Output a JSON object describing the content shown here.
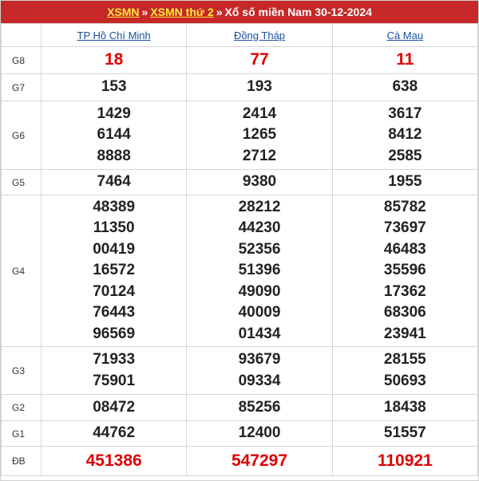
{
  "header": {
    "link1": "XSMN",
    "sep1": "»",
    "link2": "XSMN thứ 2",
    "sep2": "»",
    "title": "Xổ số miền Nam 30-12-2024"
  },
  "provinces": [
    "TP Hồ Chí Minh",
    "Đồng Tháp",
    "Cà Mau"
  ],
  "prizes": [
    {
      "label": "G8",
      "values": [
        [
          "18"
        ],
        [
          "77"
        ],
        [
          "11"
        ]
      ]
    },
    {
      "label": "G7",
      "values": [
        [
          "153"
        ],
        [
          "193"
        ],
        [
          "638"
        ]
      ]
    },
    {
      "label": "G6",
      "values": [
        [
          "1429",
          "6144",
          "8888"
        ],
        [
          "2414",
          "1265",
          "2712"
        ],
        [
          "3617",
          "8412",
          "2585"
        ]
      ]
    },
    {
      "label": "G5",
      "values": [
        [
          "7464"
        ],
        [
          "9380"
        ],
        [
          "1955"
        ]
      ]
    },
    {
      "label": "G4",
      "values": [
        [
          "48389",
          "11350",
          "00419",
          "16572",
          "70124",
          "76443",
          "96569"
        ],
        [
          "28212",
          "44230",
          "52356",
          "51396",
          "49090",
          "40009",
          "01434"
        ],
        [
          "85782",
          "73697",
          "46483",
          "35596",
          "17362",
          "68306",
          "23941"
        ]
      ]
    },
    {
      "label": "G3",
      "values": [
        [
          "71933",
          "75901"
        ],
        [
          "93679",
          "09334"
        ],
        [
          "28155",
          "50693"
        ]
      ]
    },
    {
      "label": "G2",
      "values": [
        [
          "08472"
        ],
        [
          "85256"
        ],
        [
          "18438"
        ]
      ]
    },
    {
      "label": "G1",
      "values": [
        [
          "44762"
        ],
        [
          "12400"
        ],
        [
          "51557"
        ]
      ]
    },
    {
      "label": "ĐB",
      "values": [
        [
          "451386"
        ],
        [
          "547297"
        ],
        [
          "110921"
        ]
      ]
    }
  ],
  "colors": {
    "header_bg": "#c62828",
    "link_yellow": "#ffeb3b",
    "highlight_red": "#e00000",
    "province_link": "#1a4fa3"
  }
}
